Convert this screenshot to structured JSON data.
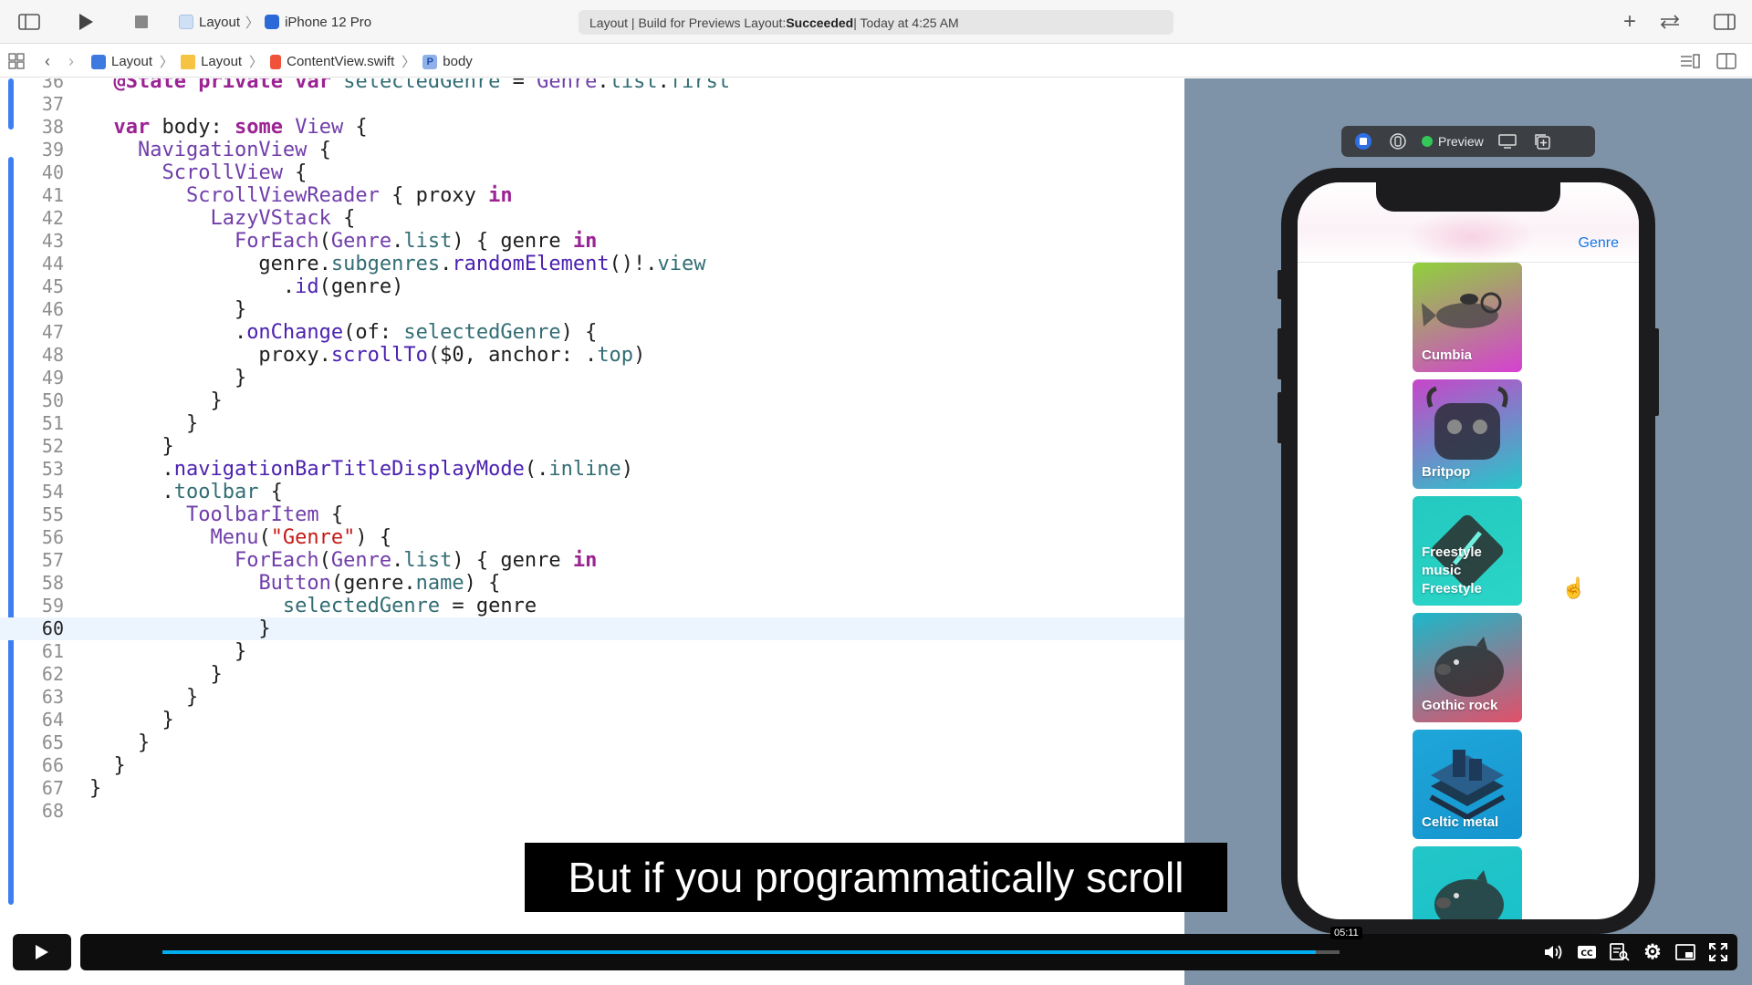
{
  "toolbar": {
    "project": "Layout",
    "device": "iPhone 12 Pro",
    "status_prefix": "Layout | Build for Previews Layout: ",
    "status_bold": "Succeeded",
    "status_suffix": " | Today at 4:25 AM"
  },
  "breadcrumbs": [
    "Layout",
    "Layout",
    "ContentView.swift",
    "body"
  ],
  "editor": {
    "current_line": 60,
    "lines": [
      {
        "n": "36",
        "t": "  @State private var selectedGenre = Genre.list.first"
      },
      {
        "n": "37",
        "t": ""
      },
      {
        "n": "38",
        "t": "  var body: some View {"
      },
      {
        "n": "39",
        "t": "    NavigationView {"
      },
      {
        "n": "40",
        "t": "      ScrollView {"
      },
      {
        "n": "41",
        "t": "        ScrollViewReader { proxy in"
      },
      {
        "n": "42",
        "t": "          LazyVStack {"
      },
      {
        "n": "43",
        "t": "            ForEach(Genre.list) { genre in"
      },
      {
        "n": "44",
        "t": "              genre.subgenres.randomElement()!.view"
      },
      {
        "n": "45",
        "t": "                .id(genre)"
      },
      {
        "n": "46",
        "t": "            }"
      },
      {
        "n": "47",
        "t": "            .onChange(of: selectedGenre) {"
      },
      {
        "n": "48",
        "t": "              proxy.scrollTo($0, anchor: .top)"
      },
      {
        "n": "49",
        "t": "            }"
      },
      {
        "n": "50",
        "t": "          }"
      },
      {
        "n": "51",
        "t": "        }"
      },
      {
        "n": "52",
        "t": "      }"
      },
      {
        "n": "53",
        "t": "      .navigationBarTitleDisplayMode(.inline)"
      },
      {
        "n": "54",
        "t": "      .toolbar {"
      },
      {
        "n": "55",
        "t": "        ToolbarItem {"
      },
      {
        "n": "56",
        "t": "          Menu(\"Genre\") {"
      },
      {
        "n": "57",
        "t": "            ForEach(Genre.list) { genre in"
      },
      {
        "n": "58",
        "t": "              Button(genre.name) {"
      },
      {
        "n": "59",
        "t": "                selectedGenre = genre"
      },
      {
        "n": "60",
        "t": "              }"
      },
      {
        "n": "61",
        "t": "            }"
      },
      {
        "n": "62",
        "t": "          }"
      },
      {
        "n": "63",
        "t": "        }"
      },
      {
        "n": "64",
        "t": "      }"
      },
      {
        "n": "65",
        "t": "    }"
      },
      {
        "n": "66",
        "t": "  }"
      },
      {
        "n": "67",
        "t": "}"
      },
      {
        "n": "68",
        "t": ""
      }
    ]
  },
  "preview": {
    "label": "Preview",
    "menu_label": "Genre",
    "tiles": [
      {
        "label": "Cumbia",
        "c1": "#8fd23a",
        "c2": "#d640d2",
        "icon": "fish-plane-icon"
      },
      {
        "label": "Britpop",
        "c1": "#c746c9",
        "c2": "#25c7c9",
        "icon": "robot-icon"
      },
      {
        "label": "Freestyle music\nFreestyle",
        "c1": "#24c9bf",
        "c2": "#2ad5c7",
        "icon": "diamond-icon"
      },
      {
        "label": "Gothic rock",
        "c1": "#1bb8c9",
        "c2": "#e34f6a",
        "icon": "pig-icon"
      },
      {
        "label": "Celtic metal",
        "c1": "#1fa6d9",
        "c2": "#1595cf",
        "icon": "stack-icon"
      },
      {
        "label": "",
        "c1": "#22c6c8",
        "c2": "#19c0cb",
        "icon": "pig-icon"
      }
    ]
  },
  "caption": "But if you programmatically scroll",
  "player": {
    "time": "05:11",
    "progress": 0.98
  }
}
